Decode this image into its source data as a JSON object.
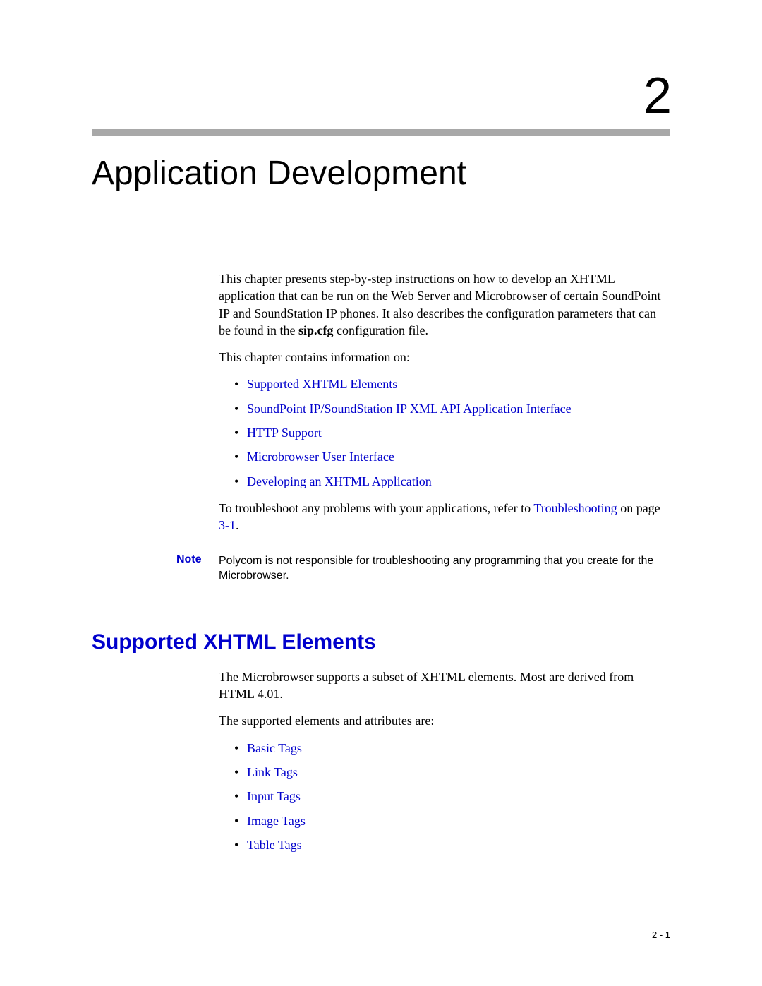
{
  "chapter": {
    "number": "2",
    "title": "Application Development"
  },
  "intro": {
    "p1_a": "This chapter presents step-by-step instructions on how to develop an XHTML application that can be run on the Web Server and Microbrowser of certain SoundPoint IP and SoundStation IP phones. It also describes the configuration parameters that can be found in the ",
    "p1_bold": "sip.cfg",
    "p1_b": " configuration file.",
    "p2": "This chapter contains information on:",
    "links": [
      "Supported XHTML Elements",
      "SoundPoint IP/SoundStation IP XML API Application Interface",
      "HTTP Support",
      "Microbrowser User Interface",
      "Developing an XHTML Application"
    ],
    "trouble_a": "To troubleshoot any problems with your applications, refer to ",
    "trouble_link": "Troubleshooting",
    "trouble_b": " on page ",
    "trouble_page": "3-1",
    "trouble_c": "."
  },
  "note": {
    "label": "Note",
    "text": "Polycom is not responsible for troubleshooting any programming that you create for the Microbrowser."
  },
  "section": {
    "title": "Supported XHTML Elements",
    "p1": "The Microbrowser supports a subset of XHTML elements. Most are derived from HTML 4.01.",
    "p2": "The supported elements and attributes are:",
    "links": [
      "Basic Tags",
      "Link Tags",
      "Input Tags",
      "Image Tags",
      "Table Tags"
    ]
  },
  "footer": {
    "page": "2 - 1"
  }
}
